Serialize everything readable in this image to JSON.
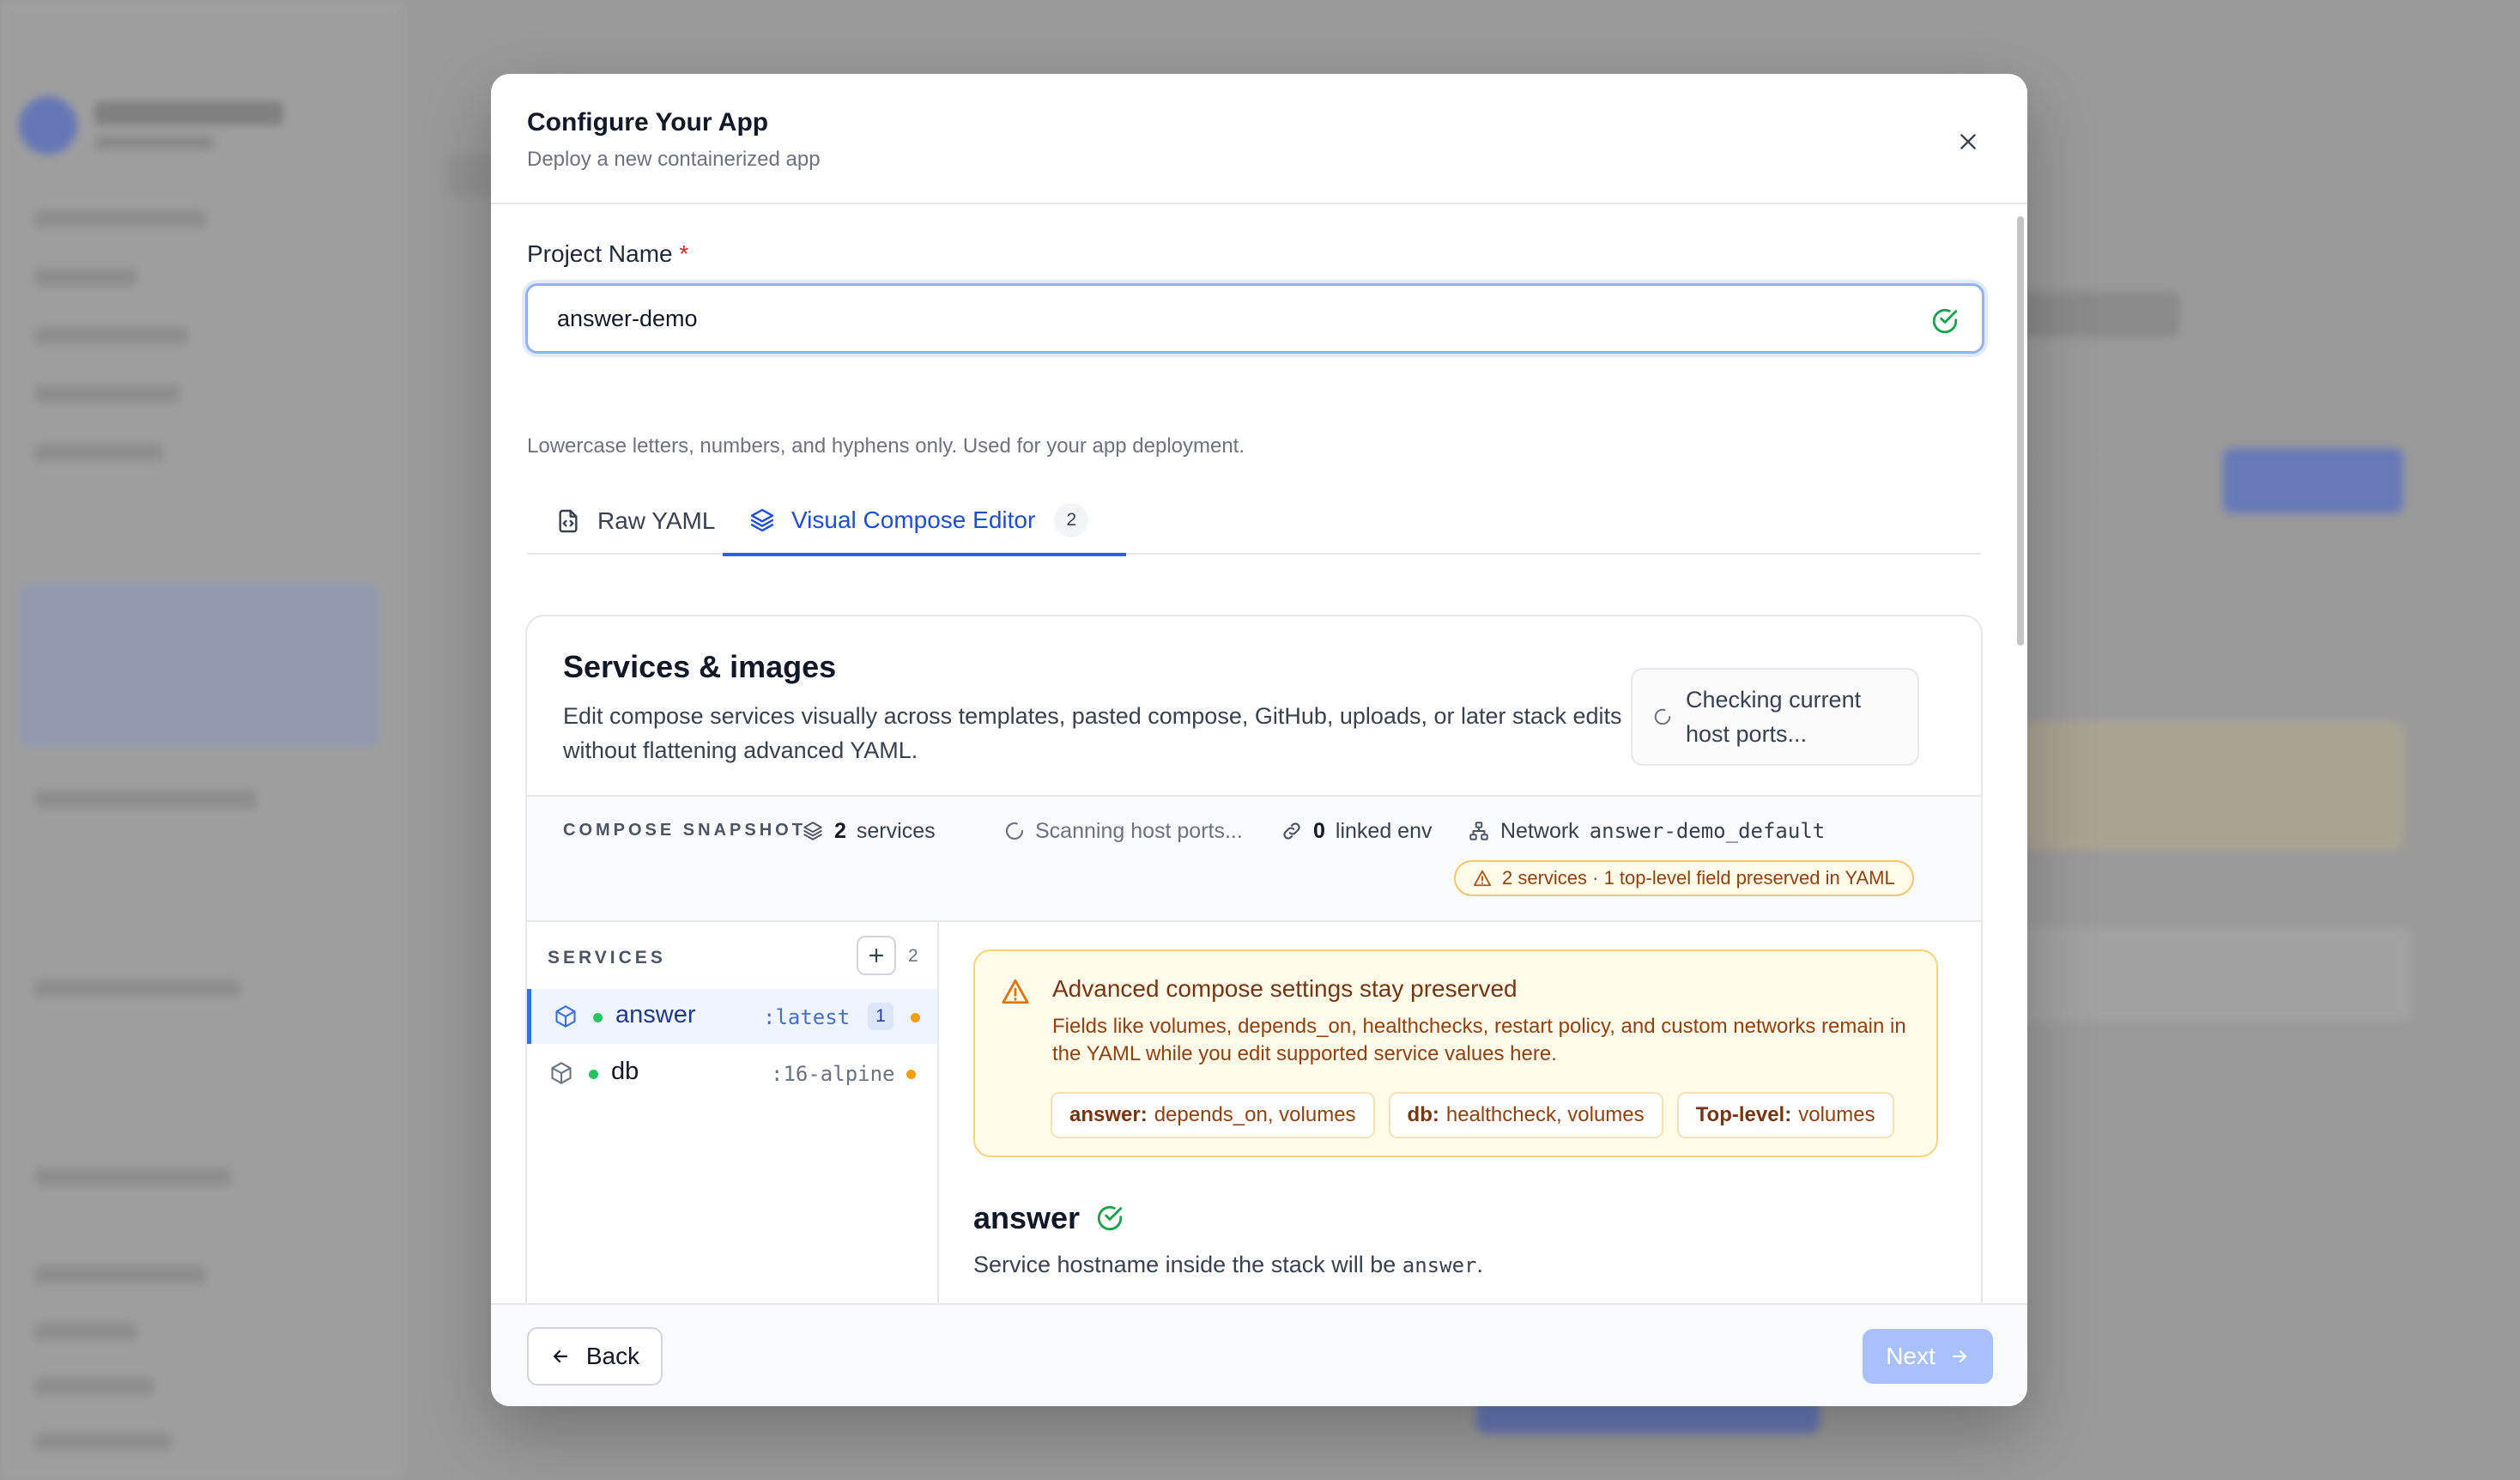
{
  "modal": {
    "title": "Configure Your App",
    "subtitle": "Deploy a new containerized app"
  },
  "project": {
    "label": "Project Name",
    "required_marker": "*",
    "value": "answer-demo",
    "help": "Lowercase letters, numbers, and hyphens only. Used for your app deployment."
  },
  "tabs": [
    {
      "label": "Raw YAML",
      "active": false
    },
    {
      "label": "Visual Compose Editor",
      "active": true,
      "badge": "2"
    }
  ],
  "editor": {
    "title": "Services & images",
    "description": "Edit compose services visually across templates, pasted compose, GitHub, uploads, or later stack edits without flattening advanced YAML.",
    "checking": "Checking current host ports..."
  },
  "snapshot": {
    "label": "COMPOSE SNAPSHOT",
    "services_count": "2",
    "services_label": "services",
    "scanning": "Scanning host ports...",
    "linked_count": "0",
    "linked_label": "linked env",
    "network_label": "Network",
    "network_value": "answer-demo_default",
    "warning": "2 services · 1 top-level field preserved in YAML"
  },
  "services": {
    "header": "SERVICES",
    "count": "2",
    "items": [
      {
        "name": "answer",
        "tag": ":latest",
        "badge": "1",
        "active": true
      },
      {
        "name": "db",
        "tag": ":16-alpine",
        "active": false
      }
    ]
  },
  "advanced": {
    "title": "Advanced compose settings stay preserved",
    "text": "Fields like volumes, depends_on, healthchecks, restart policy, and custom networks remain in the YAML while you edit supported service values here.",
    "chips": [
      {
        "key": "answer:",
        "value": "depends_on, volumes"
      },
      {
        "key": "db:",
        "value": "healthcheck, volumes"
      },
      {
        "key": "Top-level:",
        "value": "volumes"
      }
    ]
  },
  "detail": {
    "service_name": "answer",
    "host_prefix": "Service hostname inside the stack will be",
    "host_value": "answer",
    "host_suffix": "."
  },
  "footer": {
    "back": "Back",
    "next": "Next"
  },
  "colors": {
    "accent": "#2563eb",
    "warning": "#f59e0b",
    "success": "#22c55e"
  }
}
